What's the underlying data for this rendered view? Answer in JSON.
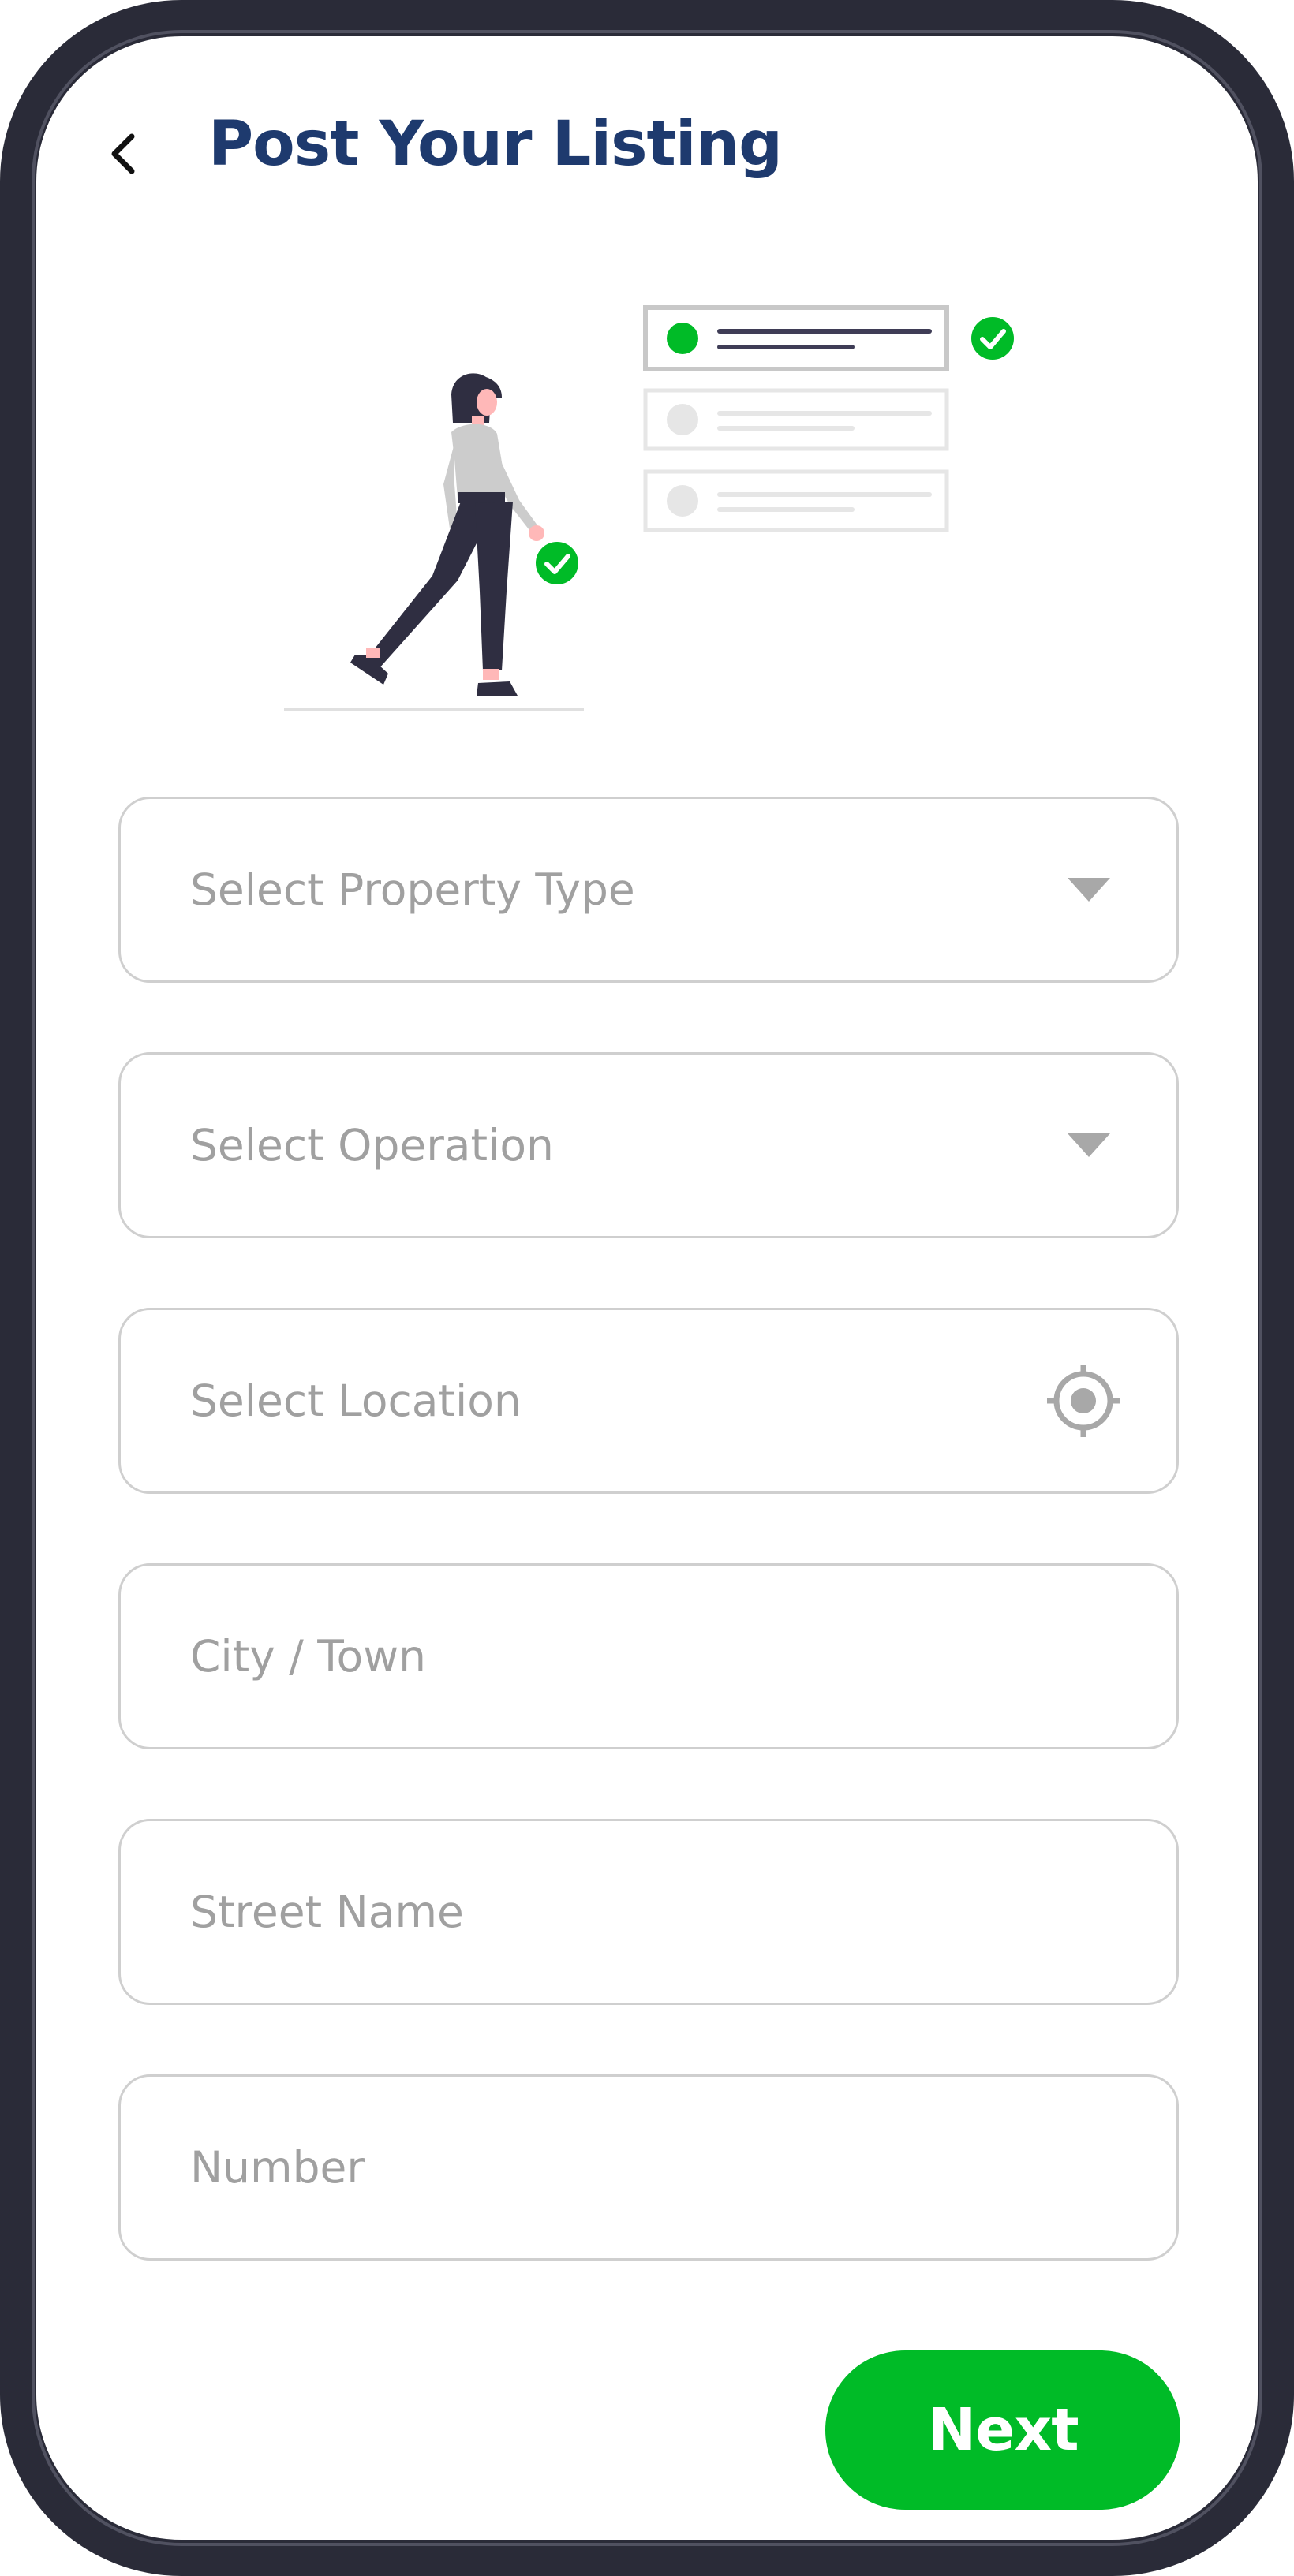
{
  "header": {
    "title": "Post Your Listing",
    "back_icon": "chevron-left-icon"
  },
  "form": {
    "fields": [
      {
        "placeholder": "Select Property Type",
        "icon": "chevron-down-icon"
      },
      {
        "placeholder": "Select Operation",
        "icon": "chevron-down-icon"
      },
      {
        "placeholder": "Select Location",
        "icon": "location-target-icon"
      },
      {
        "placeholder": "City / Town"
      },
      {
        "placeholder": "Street Name"
      },
      {
        "placeholder": "Number"
      }
    ]
  },
  "actions": {
    "next_label": "Next"
  },
  "colors": {
    "title": "#1e3a6e",
    "accent_green": "#00bb27",
    "placeholder": "#a0a0a0",
    "field_border": "#cfcfcf",
    "frame": "#2a2b38"
  }
}
